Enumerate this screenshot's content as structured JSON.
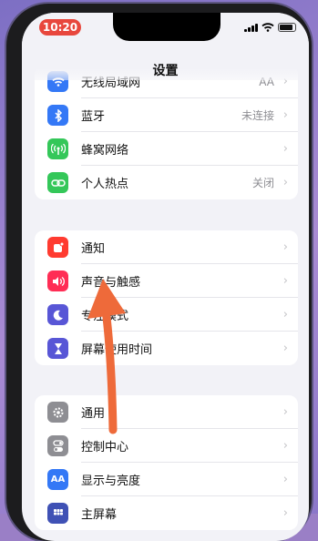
{
  "status_bar": {
    "time": "10:20"
  },
  "nav": {
    "title": "设置"
  },
  "groups": [
    {
      "items": [
        {
          "label": "无线局域网",
          "value": "AA",
          "icon": "wifi-icon",
          "color": "#3478f6"
        },
        {
          "label": "蓝牙",
          "value": "未连接",
          "icon": "bluetooth-icon",
          "color": "#3478f6"
        },
        {
          "label": "蜂窝网络",
          "value": "",
          "icon": "cellular-icon",
          "color": "#34c759"
        },
        {
          "label": "个人热点",
          "value": "关闭",
          "icon": "hotspot-icon",
          "color": "#34c759"
        }
      ]
    },
    {
      "items": [
        {
          "label": "通知",
          "icon": "notification-icon",
          "color": "#ff3b30"
        },
        {
          "label": "声音与触感",
          "icon": "speaker-icon",
          "color": "#ff2d55"
        },
        {
          "label": "专注模式",
          "icon": "moon-icon",
          "color": "#5856d6"
        },
        {
          "label": "屏幕使用时间",
          "icon": "hourglass-icon",
          "color": "#5856d6"
        }
      ]
    },
    {
      "items": [
        {
          "label": "通用",
          "icon": "gear-icon",
          "color": "#8e8e93"
        },
        {
          "label": "控制中心",
          "icon": "toggle-icon",
          "color": "#8e8e93"
        },
        {
          "label": "显示与亮度",
          "icon": "display-icon",
          "color": "#3478f6"
        },
        {
          "label": "主屏幕",
          "icon": "home-screen-icon",
          "color": "#3f51b5"
        }
      ]
    }
  ],
  "annotation": {
    "color": "#ee6a3a",
    "points_to": "声音与触感"
  }
}
